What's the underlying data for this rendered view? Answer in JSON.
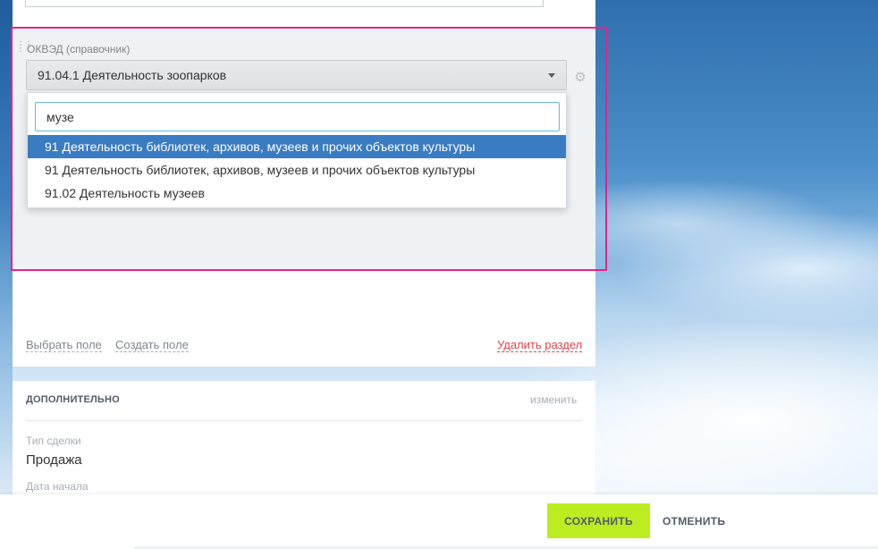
{
  "section": {
    "field_label": "ОКВЭД (справочник)",
    "selected_value": "91.04.1 Деятельность зоопарков",
    "search_value": "музе",
    "options": [
      {
        "label": "91 Деятельность библиотек, архивов, музеев и прочих объектов культуры",
        "highlighted": true
      },
      {
        "label": "91 Деятельность библиотек, архивов, музеев и прочих объектов культуры",
        "highlighted": false
      },
      {
        "label": "91.02 Деятельность музеев",
        "highlighted": false
      }
    ],
    "link_select_field": "Выбрать поле",
    "link_create_field": "Создать поле",
    "link_delete_section": "Удалить раздел"
  },
  "extra": {
    "title": "ДОПОЛНИТЕЛЬНО",
    "edit_label": "изменить",
    "deal_type_label": "Тип сделки",
    "deal_type_value": "Продажа",
    "start_date_label": "Дата начала"
  },
  "footer": {
    "save_label": "СОХРАНИТЬ",
    "cancel_label": "ОТМЕНИТЬ"
  },
  "colors": {
    "accent_save": "#bbed21",
    "selection": "#3a7cc2",
    "highlight_frame": "#ec1f84",
    "delete_link": "#e0424b"
  },
  "icons": {
    "drag": "drag-handle-icon",
    "dropdown": "chevron-down-icon",
    "settings": "gear-icon"
  }
}
